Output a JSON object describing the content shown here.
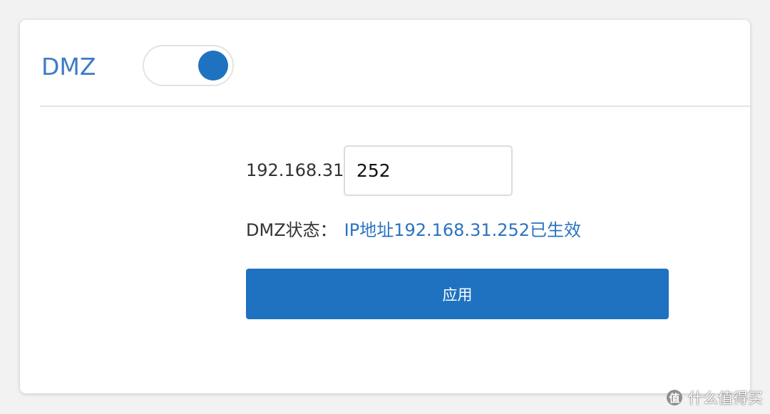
{
  "header": {
    "title": "DMZ"
  },
  "toggle": {
    "state": "on",
    "color": "#1f72bf"
  },
  "form": {
    "ip_prefix": "192.168.31.",
    "ip_last_octet": "252",
    "status_label": "DMZ状态：",
    "status_value": "IP地址192.168.31.252已生效",
    "apply_label": "应用"
  },
  "watermark": {
    "logo_text": "值",
    "text": "什么值得买"
  },
  "colors": {
    "accent": "#1f72bf",
    "title": "#3e7bc6",
    "status_value": "#2a73c0"
  }
}
